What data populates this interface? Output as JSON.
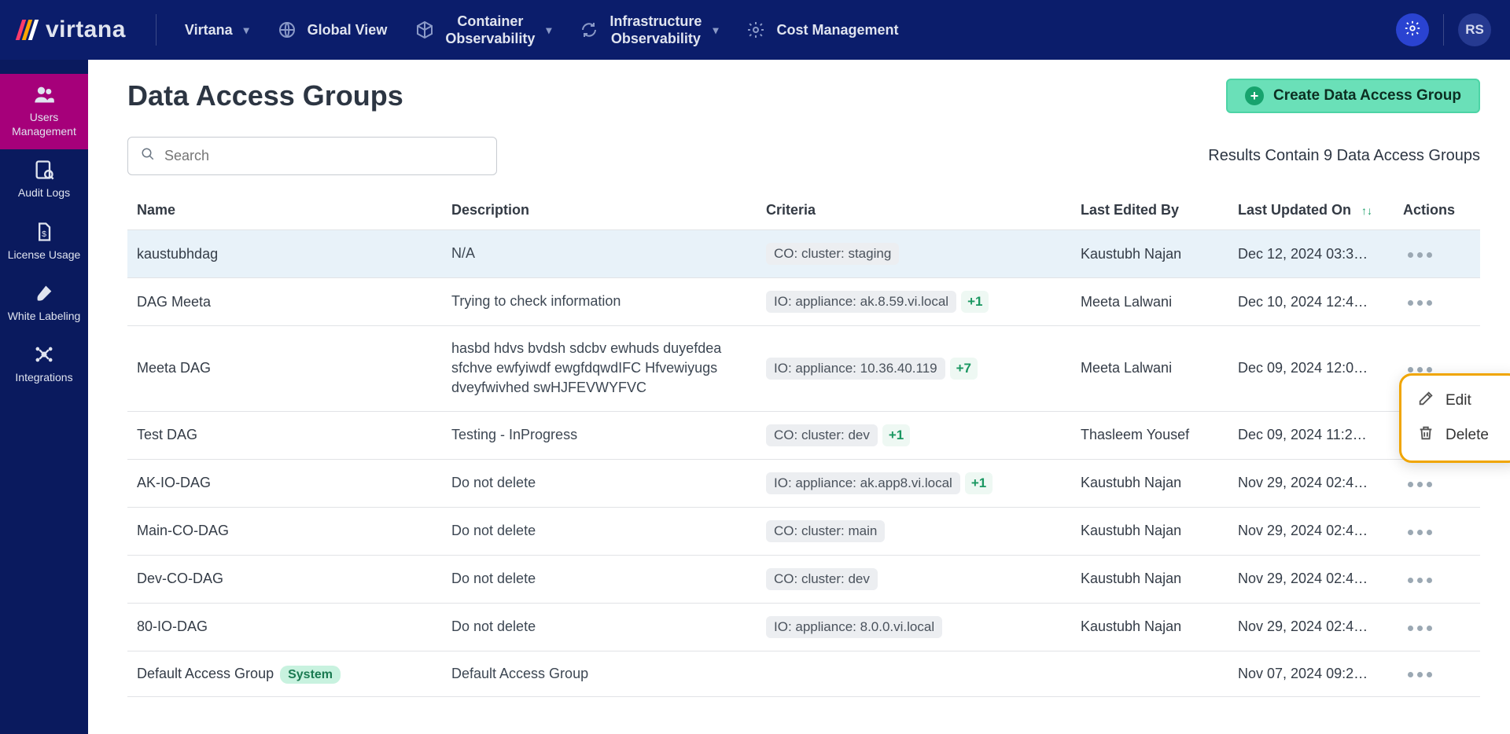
{
  "brand": {
    "name": "virtana"
  },
  "topnav": {
    "org": "Virtana",
    "items": [
      {
        "label": "Global View",
        "twoline": false
      },
      {
        "label1": "Container",
        "label2": "Observability",
        "twoline": true
      },
      {
        "label1": "Infrastructure",
        "label2": "Observability",
        "twoline": true
      },
      {
        "label": "Cost Management",
        "twoline": false
      }
    ],
    "avatar": "RS"
  },
  "sidebar": [
    {
      "label1": "Users",
      "label2": "Management",
      "active": true
    },
    {
      "label1": "Audit Logs",
      "label2": "",
      "active": false
    },
    {
      "label1": "License Usage",
      "label2": "",
      "active": false
    },
    {
      "label1": "White Labeling",
      "label2": "",
      "active": false
    },
    {
      "label1": "Integrations",
      "label2": "",
      "active": false
    }
  ],
  "page": {
    "title": "Data Access Groups",
    "createBtn": "Create Data Access Group",
    "searchPlaceholder": "Search",
    "resultsText": "Results Contain 9 Data Access Groups"
  },
  "columns": {
    "name": "Name",
    "description": "Description",
    "criteria": "Criteria",
    "lastEditedBy": "Last Edited By",
    "lastUpdated": "Last Updated On",
    "actions": "Actions"
  },
  "rows": [
    {
      "name": "kaustubhdag",
      "desc": "N/A",
      "criteria": [
        {
          "text": "CO: cluster: staging"
        }
      ],
      "editedBy": "Kaustubh Najan",
      "updated": "Dec 12, 2024 03:3…",
      "highlight": true
    },
    {
      "name": "DAG Meeta",
      "desc": "Trying to check information",
      "criteria": [
        {
          "text": "IO: appliance: ak.8.59.vi.local"
        },
        {
          "plus": "+1"
        }
      ],
      "editedBy": "Meeta Lalwani",
      "updated": "Dec 10, 2024 12:4…"
    },
    {
      "name": "Meeta DAG",
      "desc": "hasbd hdvs bvdsh sdcbv ewhuds duyefdea sfchve ewfyiwdf ewgfdqwdIFC Hfvewiyugs dveyfwivhed swHJFEVWYFVC",
      "criteria": [
        {
          "text": "IO: appliance: 10.36.40.119"
        },
        {
          "plus": "+7"
        }
      ],
      "editedBy": "Meeta Lalwani",
      "updated": "Dec 09, 2024 12:0…"
    },
    {
      "name": "Test DAG",
      "desc": "Testing - InProgress",
      "criteria": [
        {
          "text": "CO: cluster: dev"
        },
        {
          "plus": "+1"
        }
      ],
      "editedBy": "Thasleem Yousef",
      "updated": "Dec 09, 2024 11:2…"
    },
    {
      "name": "AK-IO-DAG",
      "desc": "Do not delete",
      "criteria": [
        {
          "text": "IO: appliance: ak.app8.vi.local"
        },
        {
          "plus": "+1"
        }
      ],
      "editedBy": "Kaustubh Najan",
      "updated": "Nov 29, 2024 02:4…"
    },
    {
      "name": "Main-CO-DAG",
      "desc": "Do not delete",
      "criteria": [
        {
          "text": "CO: cluster: main"
        }
      ],
      "editedBy": "Kaustubh Najan",
      "updated": "Nov 29, 2024 02:4…"
    },
    {
      "name": "Dev-CO-DAG",
      "desc": "Do not delete",
      "criteria": [
        {
          "text": "CO: cluster: dev"
        }
      ],
      "editedBy": "Kaustubh Najan",
      "updated": "Nov 29, 2024 02:4…"
    },
    {
      "name": "80-IO-DAG",
      "desc": "Do not delete",
      "criteria": [
        {
          "text": "IO: appliance: 8.0.0.vi.local"
        }
      ],
      "editedBy": "Kaustubh Najan",
      "updated": "Nov 29, 2024 02:4…"
    },
    {
      "name": "Default Access Group",
      "badge": "System",
      "desc": "Default Access Group",
      "criteria": [],
      "editedBy": "",
      "updated": "Nov 07, 2024 09:2…"
    }
  ],
  "dropdown": {
    "edit": "Edit",
    "delete": "Delete"
  }
}
